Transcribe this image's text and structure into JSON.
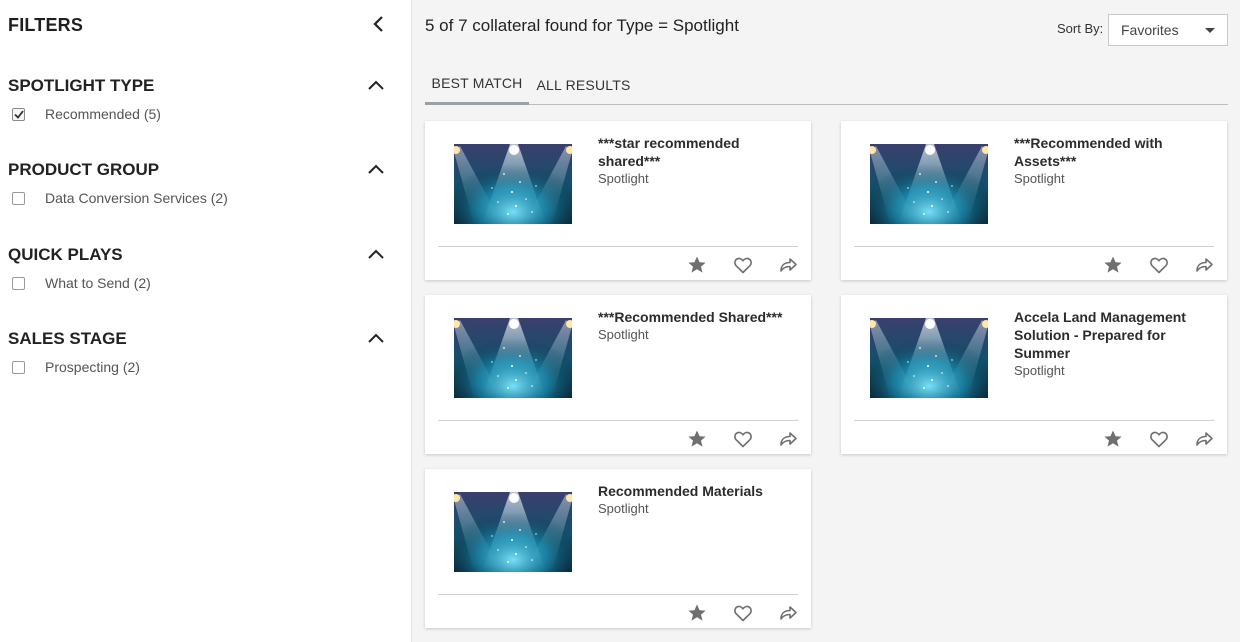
{
  "sidebar": {
    "title": "FILTERS",
    "groups": [
      {
        "title": "SPOTLIGHT TYPE",
        "option": {
          "label": "Recommended (5)",
          "checked": true
        }
      },
      {
        "title": "PRODUCT GROUP",
        "option": {
          "label": "Data Conversion Services (2)",
          "checked": false
        }
      },
      {
        "title": "QUICK PLAYS",
        "option": {
          "label": "What to Send (2)",
          "checked": false
        }
      },
      {
        "title": "SALES STAGE",
        "option": {
          "label": "Prospecting (2)",
          "checked": false
        }
      }
    ]
  },
  "main": {
    "summary": "5 of 7 collateral found for Type = Spotlight",
    "sort": {
      "label": "Sort By:",
      "value": "Favorites"
    },
    "tabs": [
      {
        "label": "BEST MATCH",
        "active": true
      },
      {
        "label": "ALL RESULTS",
        "active": false
      }
    ],
    "cards": [
      {
        "title": "***star recommended shared***",
        "type": "Spotlight"
      },
      {
        "title": "***Recommended with Assets***",
        "type": "Spotlight"
      },
      {
        "title": "***Recommended Shared***",
        "type": "Spotlight"
      },
      {
        "title": "Accela Land Management Solution - Prepared for Summer",
        "type": "Spotlight"
      },
      {
        "title": "Recommended Materials",
        "type": "Spotlight"
      }
    ]
  },
  "icons": {
    "collapse": "chevron-left-icon",
    "group_toggle": "chevron-up-icon",
    "favorite": "star-icon",
    "like": "heart-icon",
    "share": "share-icon"
  },
  "colors": {
    "icon_gray": "#6f6f6f",
    "thumb_dark": "#0e2a3c",
    "thumb_light": "#39c4e8"
  }
}
